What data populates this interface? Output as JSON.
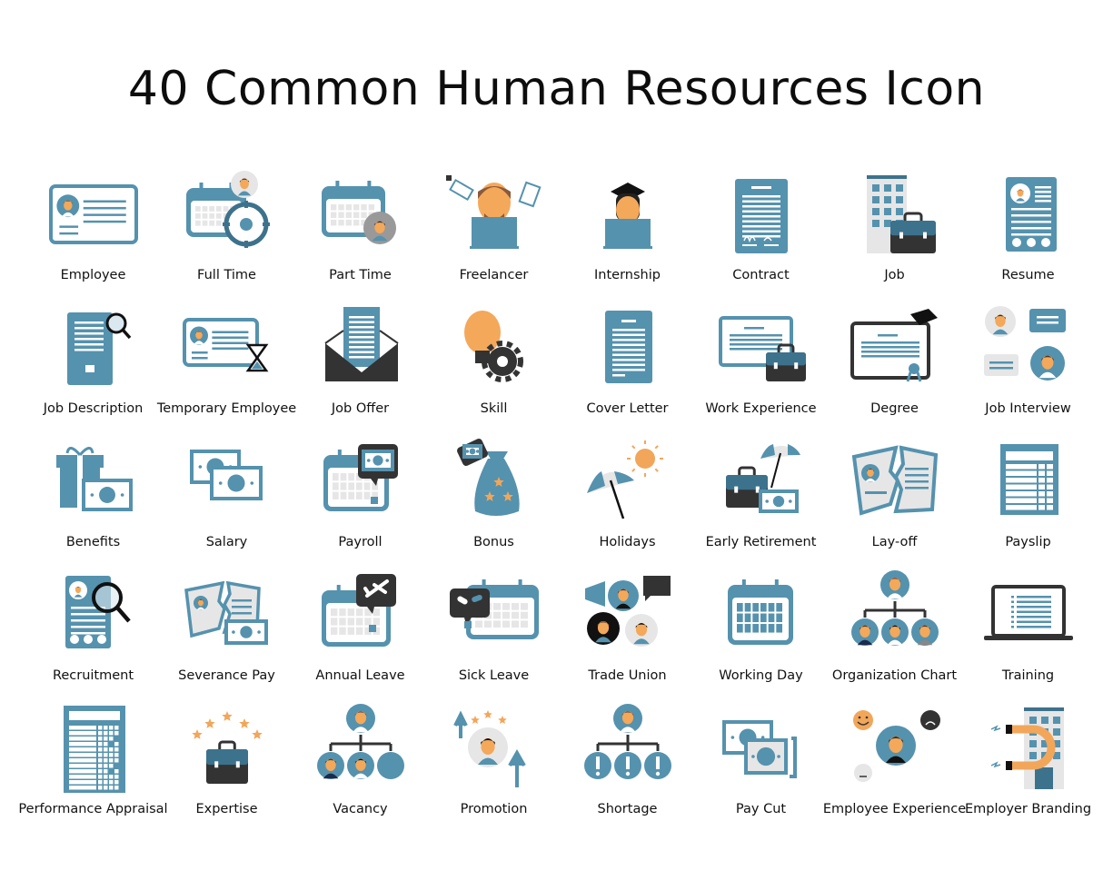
{
  "title": "40 Common Human Resources Icon",
  "colors": {
    "blue": "#5592ae",
    "dark_blue": "#3d728c",
    "light_gray": "#e6e6e6",
    "dark": "#333333",
    "skin": "#f4a85a",
    "hair": "#8a5a3b",
    "star": "#f2a65a"
  },
  "icons": [
    {
      "label": "Employee",
      "icon": "id-card-icon"
    },
    {
      "label": "Full Time",
      "icon": "calendar-clock-icon"
    },
    {
      "label": "Part Time",
      "icon": "calendar-person-icon"
    },
    {
      "label": "Freelancer",
      "icon": "freelancer-laptop-icon"
    },
    {
      "label": "Internship",
      "icon": "graduate-laptop-icon"
    },
    {
      "label": "Contract",
      "icon": "signed-document-icon"
    },
    {
      "label": "Job",
      "icon": "building-briefcase-icon"
    },
    {
      "label": "Resume",
      "icon": "resume-icon"
    },
    {
      "label": "Job Description",
      "icon": "document-search-icon"
    },
    {
      "label": "Temporary Employee",
      "icon": "id-card-hourglass-icon"
    },
    {
      "label": "Job Offer",
      "icon": "envelope-letter-icon"
    },
    {
      "label": "Skill",
      "icon": "lightbulb-gear-icon"
    },
    {
      "label": "Cover Letter",
      "icon": "letter-document-icon"
    },
    {
      "label": "Work Experience",
      "icon": "certificate-briefcase-icon"
    },
    {
      "label": "Degree",
      "icon": "diploma-cap-icon"
    },
    {
      "label": "Job Interview",
      "icon": "interview-chat-icon"
    },
    {
      "label": "Benefits",
      "icon": "gift-money-icon"
    },
    {
      "label": "Salary",
      "icon": "banknotes-icon"
    },
    {
      "label": "Payroll",
      "icon": "calendar-money-icon"
    },
    {
      "label": "Bonus",
      "icon": "money-bag-icon"
    },
    {
      "label": "Holidays",
      "icon": "umbrella-sun-icon"
    },
    {
      "label": "Early Retirement",
      "icon": "briefcase-umbrella-icon"
    },
    {
      "label": "Lay-off",
      "icon": "torn-id-card-icon"
    },
    {
      "label": "Payslip",
      "icon": "payslip-table-icon"
    },
    {
      "label": "Recruitment",
      "icon": "resume-magnifier-icon"
    },
    {
      "label": "Severance Pay",
      "icon": "torn-card-money-icon"
    },
    {
      "label": "Annual Leave",
      "icon": "calendar-plane-icon"
    },
    {
      "label": "Sick Leave",
      "icon": "calendar-pills-icon"
    },
    {
      "label": "Trade Union",
      "icon": "megaphone-group-icon"
    },
    {
      "label": "Working Day",
      "icon": "calendar-icon"
    },
    {
      "label": "Organization Chart",
      "icon": "org-chart-icon"
    },
    {
      "label": "Training",
      "icon": "laptop-list-icon"
    },
    {
      "label": "Performance Appraisal",
      "icon": "appraisal-sheet-icon"
    },
    {
      "label": "Expertise",
      "icon": "briefcase-stars-icon"
    },
    {
      "label": "Vacancy",
      "icon": "org-chart-vacancy-icon"
    },
    {
      "label": "Promotion",
      "icon": "person-arrows-icon"
    },
    {
      "label": "Shortage",
      "icon": "org-chart-alert-icon"
    },
    {
      "label": "Pay Cut",
      "icon": "cut-banknotes-icon"
    },
    {
      "label": "Employee Experience",
      "icon": "person-emotions-icon"
    },
    {
      "label": "Employer Branding",
      "icon": "building-magnet-icon"
    }
  ]
}
